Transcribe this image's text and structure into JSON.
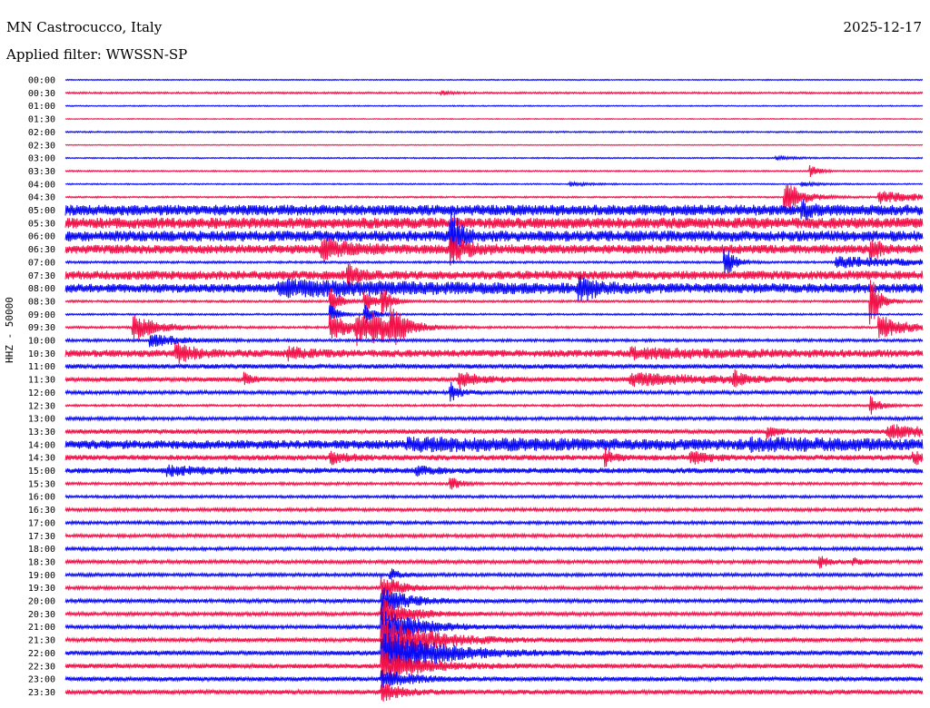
{
  "header": {
    "station": "MN Castrocucco, Italy",
    "date": "2025-12-17",
    "filter": "Applied filter: WWSSN-SP"
  },
  "y_axis_label": "HHZ - 50000",
  "colors": {
    "odd_rows": "#0a0af5",
    "even_rows": "#f2124a"
  },
  "chart_data": {
    "type": "line",
    "title": "",
    "ylabel": "HHZ - 50000",
    "xlabel": "",
    "grid": false,
    "rows": [
      {
        "label": "00:00",
        "noise": 0.6,
        "events": []
      },
      {
        "label": "00:30",
        "noise": 1.0,
        "events": [
          {
            "t": 0.44,
            "amp": 2,
            "dur": 0.01
          }
        ]
      },
      {
        "label": "01:00",
        "noise": 0.6,
        "events": []
      },
      {
        "label": "01:30",
        "noise": 0.5,
        "events": []
      },
      {
        "label": "02:00",
        "noise": 0.8,
        "events": []
      },
      {
        "label": "02:30",
        "noise": 0.5,
        "events": []
      },
      {
        "label": "03:00",
        "noise": 0.7,
        "events": [
          {
            "t": 0.83,
            "amp": 2,
            "dur": 0.02
          }
        ]
      },
      {
        "label": "03:30",
        "noise": 0.8,
        "events": [
          {
            "t": 0.87,
            "amp": 6,
            "dur": 0.01
          }
        ]
      },
      {
        "label": "04:00",
        "noise": 0.7,
        "events": [
          {
            "t": 0.59,
            "amp": 2,
            "dur": 0.02
          },
          {
            "t": 0.86,
            "amp": 2,
            "dur": 0.02
          }
        ]
      },
      {
        "label": "04:30",
        "noise": 0.9,
        "events": [
          {
            "t": 0.84,
            "amp": 18,
            "dur": 0.02
          },
          {
            "t": 0.95,
            "amp": 7,
            "dur": 0.05
          }
        ]
      },
      {
        "label": "05:00",
        "noise": 6.0,
        "events": [
          {
            "t": 0.86,
            "amp": 8,
            "dur": 0.01
          }
        ]
      },
      {
        "label": "05:30",
        "noise": 6.0,
        "events": []
      },
      {
        "label": "06:00",
        "noise": 6.0,
        "events": [
          {
            "t": 0.45,
            "amp": 30,
            "dur": 0.01
          }
        ]
      },
      {
        "label": "06:30",
        "noise": 5.0,
        "events": [
          {
            "t": 0.3,
            "amp": 12,
            "dur": 0.03
          },
          {
            "t": 0.45,
            "amp": 12,
            "dur": 0.02
          },
          {
            "t": 0.94,
            "amp": 12,
            "dur": 0.01
          }
        ]
      },
      {
        "label": "07:00",
        "noise": 1.2,
        "events": [
          {
            "t": 0.77,
            "amp": 18,
            "dur": 0.01
          },
          {
            "t": 0.9,
            "amp": 6,
            "dur": 0.1
          }
        ]
      },
      {
        "label": "07:30",
        "noise": 5.0,
        "events": [
          {
            "t": 0.33,
            "amp": 12,
            "dur": 0.01
          }
        ]
      },
      {
        "label": "08:00",
        "noise": 5.0,
        "events": [
          {
            "t": 0.25,
            "amp": 6,
            "dur": 0.2
          },
          {
            "t": 0.6,
            "amp": 12,
            "dur": 0.02
          }
        ]
      },
      {
        "label": "08:30",
        "noise": 1.2,
        "events": [
          {
            "t": 0.31,
            "amp": 14,
            "dur": 0.01
          },
          {
            "t": 0.35,
            "amp": 14,
            "dur": 0.01
          },
          {
            "t": 0.37,
            "amp": 14,
            "dur": 0.01
          },
          {
            "t": 0.94,
            "amp": 28,
            "dur": 0.01
          }
        ]
      },
      {
        "label": "09:00",
        "noise": 1.0,
        "events": [
          {
            "t": 0.31,
            "amp": 10,
            "dur": 0.01
          },
          {
            "t": 0.35,
            "amp": 10,
            "dur": 0.01
          }
        ]
      },
      {
        "label": "09:30",
        "noise": 1.2,
        "events": [
          {
            "t": 0.08,
            "amp": 14,
            "dur": 0.03
          },
          {
            "t": 0.31,
            "amp": 16,
            "dur": 0.02
          },
          {
            "t": 0.34,
            "amp": 16,
            "dur": 0.02
          },
          {
            "t": 0.36,
            "amp": 16,
            "dur": 0.02
          },
          {
            "t": 0.38,
            "amp": 16,
            "dur": 0.02
          },
          {
            "t": 0.95,
            "amp": 14,
            "dur": 0.03
          }
        ]
      },
      {
        "label": "10:00",
        "noise": 1.5,
        "events": [
          {
            "t": 0.1,
            "amp": 8,
            "dur": 0.03
          }
        ]
      },
      {
        "label": "10:30",
        "noise": 4.0,
        "events": [
          {
            "t": 0.13,
            "amp": 10,
            "dur": 0.02
          },
          {
            "t": 0.26,
            "amp": 6,
            "dur": 0.02
          },
          {
            "t": 0.66,
            "amp": 4,
            "dur": 0.1
          }
        ]
      },
      {
        "label": "11:00",
        "noise": 2.5,
        "events": []
      },
      {
        "label": "11:30",
        "noise": 2.5,
        "events": [
          {
            "t": 0.21,
            "amp": 6,
            "dur": 0.01
          },
          {
            "t": 0.46,
            "amp": 10,
            "dur": 0.02
          },
          {
            "t": 0.66,
            "amp": 6,
            "dur": 0.1
          },
          {
            "t": 0.78,
            "amp": 8,
            "dur": 0.01
          }
        ]
      },
      {
        "label": "12:00",
        "noise": 2.0,
        "events": [
          {
            "t": 0.45,
            "amp": 10,
            "dur": 0.01
          }
        ]
      },
      {
        "label": "12:30",
        "noise": 1.2,
        "events": [
          {
            "t": 0.94,
            "amp": 10,
            "dur": 0.01
          }
        ]
      },
      {
        "label": "13:00",
        "noise": 1.8,
        "events": []
      },
      {
        "label": "13:30",
        "noise": 2.5,
        "events": [
          {
            "t": 0.82,
            "amp": 6,
            "dur": 0.01
          },
          {
            "t": 0.96,
            "amp": 7,
            "dur": 0.05
          }
        ]
      },
      {
        "label": "14:00",
        "noise": 5.0,
        "events": [
          {
            "t": 0.4,
            "amp": 4,
            "dur": 0.3
          },
          {
            "t": 0.8,
            "amp": 3,
            "dur": 0.2
          }
        ]
      },
      {
        "label": "14:30",
        "noise": 3.0,
        "events": [
          {
            "t": 0.31,
            "amp": 6,
            "dur": 0.02
          },
          {
            "t": 0.63,
            "amp": 8,
            "dur": 0.01
          },
          {
            "t": 0.73,
            "amp": 6,
            "dur": 0.02
          },
          {
            "t": 0.99,
            "amp": 6,
            "dur": 0.02
          }
        ]
      },
      {
        "label": "15:00",
        "noise": 3.0,
        "events": [
          {
            "t": 0.12,
            "amp": 4,
            "dur": 0.05
          },
          {
            "t": 0.41,
            "amp": 4,
            "dur": 0.02
          }
        ]
      },
      {
        "label": "15:30",
        "noise": 1.5,
        "events": [
          {
            "t": 0.45,
            "amp": 7,
            "dur": 0.01
          }
        ]
      },
      {
        "label": "16:00",
        "noise": 1.5,
        "events": []
      },
      {
        "label": "16:30",
        "noise": 1.8,
        "events": []
      },
      {
        "label": "17:00",
        "noise": 1.8,
        "events": []
      },
      {
        "label": "17:30",
        "noise": 1.8,
        "events": []
      },
      {
        "label": "18:00",
        "noise": 1.8,
        "events": []
      },
      {
        "label": "18:30",
        "noise": 2.0,
        "events": [
          {
            "t": 0.88,
            "amp": 6,
            "dur": 0.01
          },
          {
            "t": 0.92,
            "amp": 3,
            "dur": 0.01
          }
        ]
      },
      {
        "label": "19:00",
        "noise": 1.8,
        "events": [
          {
            "t": 0.38,
            "amp": 6,
            "dur": 0.01
          }
        ]
      },
      {
        "label": "19:30",
        "noise": 1.8,
        "events": [
          {
            "t": 0.37,
            "amp": 14,
            "dur": 0.02
          }
        ]
      },
      {
        "label": "20:00",
        "noise": 2.0,
        "events": [
          {
            "t": 0.37,
            "amp": 14,
            "dur": 0.03
          }
        ]
      },
      {
        "label": "20:30",
        "noise": 2.0,
        "events": [
          {
            "t": 0.37,
            "amp": 16,
            "dur": 0.03
          }
        ]
      },
      {
        "label": "21:00",
        "noise": 2.0,
        "events": [
          {
            "t": 0.37,
            "amp": 20,
            "dur": 0.04
          }
        ]
      },
      {
        "label": "21:30",
        "noise": 2.2,
        "events": [
          {
            "t": 0.37,
            "amp": 26,
            "dur": 0.05
          }
        ]
      },
      {
        "label": "22:00",
        "noise": 2.5,
        "events": [
          {
            "t": 0.37,
            "amp": 26,
            "dur": 0.06
          }
        ]
      },
      {
        "label": "22:30",
        "noise": 2.5,
        "events": [
          {
            "t": 0.37,
            "amp": 18,
            "dur": 0.04
          }
        ]
      },
      {
        "label": "23:00",
        "noise": 2.5,
        "events": [
          {
            "t": 0.37,
            "amp": 10,
            "dur": 0.03
          }
        ]
      },
      {
        "label": "23:30",
        "noise": 2.5,
        "events": [
          {
            "t": 0.37,
            "amp": 10,
            "dur": 0.02
          }
        ]
      }
    ]
  }
}
